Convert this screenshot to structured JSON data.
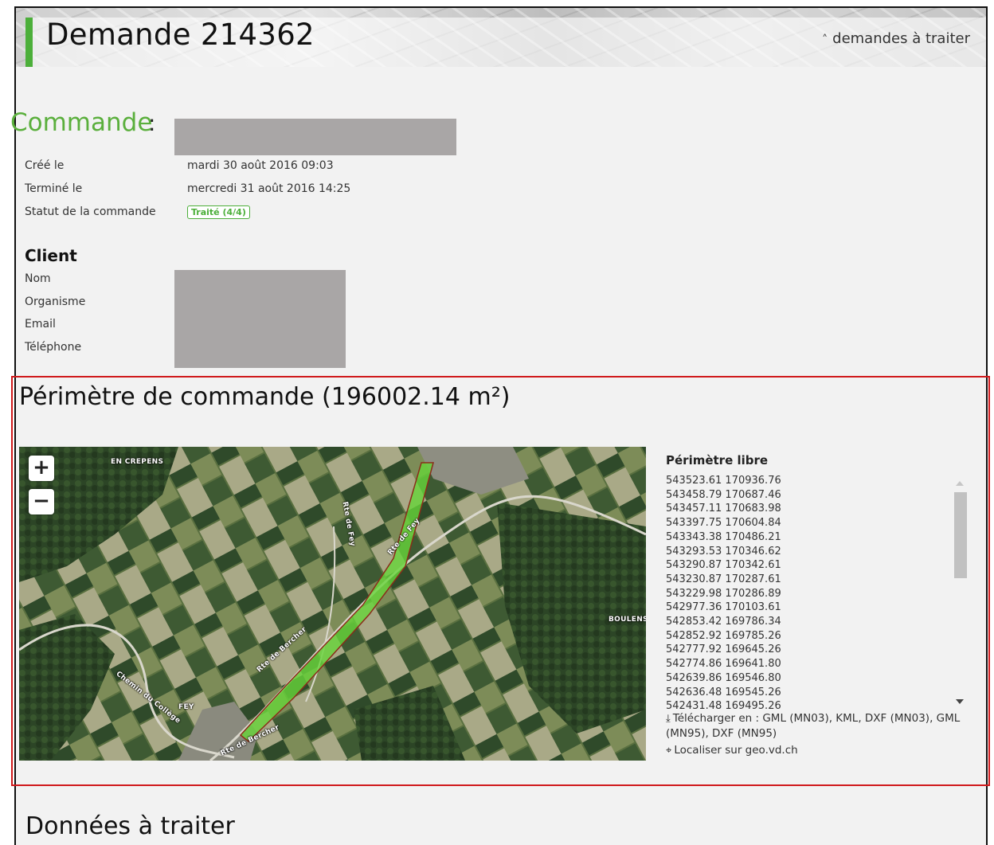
{
  "header": {
    "title": "Demande 214362",
    "back_link": "demandes à traiter",
    "back_icon": "double-chevron-up-icon",
    "accent_color": "#4caf3a"
  },
  "commande": {
    "title": "Commande",
    "colon": ":",
    "rows": [
      {
        "label": "Créé le",
        "value": "mardi 30 août 2016 09:03"
      },
      {
        "label": "Terminé le",
        "value": "mercredi 31 août 2016 14:25"
      },
      {
        "label": "Statut de la commande",
        "value": "Traité (4/4)"
      }
    ]
  },
  "client": {
    "title": "Client",
    "labels": [
      "Nom",
      "Organisme",
      "Email",
      "Téléphone"
    ]
  },
  "perimetre": {
    "title": "Périmètre de commande (196002.14 m²)",
    "map": {
      "zoom_in": "+",
      "zoom_out": "−",
      "place_labels": [
        "EN CREPENS",
        "BOULENS",
        "Rte de Bercher",
        "Rte de Fey",
        "Rte de Fey",
        "Chemin du Collège",
        "FEY",
        "Rte de Bercher"
      ]
    },
    "side_title": "Périmètre libre",
    "coordinates": [
      "543523.61 170936.76",
      "543458.79 170687.46",
      "543457.11 170683.98",
      "543397.75 170604.84",
      "543343.38 170486.21",
      "543293.53 170346.62",
      "543290.87 170342.61",
      "543230.87 170287.61",
      "543229.98 170286.89",
      "542977.36 170103.61",
      "542853.42 169786.34",
      "542852.92 169785.26",
      "542777.92 169645.26",
      "542774.86 169641.80",
      "542639.86 169546.80",
      "542636.48 169545.26",
      "542431.48 169495.26"
    ],
    "download_text": "Télécharger en : GML (MN03), KML, DXF (MN03), GML (MN95), DXF (MN95)",
    "localise_text": "Localiser sur geo.vd.ch"
  },
  "donnees": {
    "title": "Données à traiter"
  }
}
